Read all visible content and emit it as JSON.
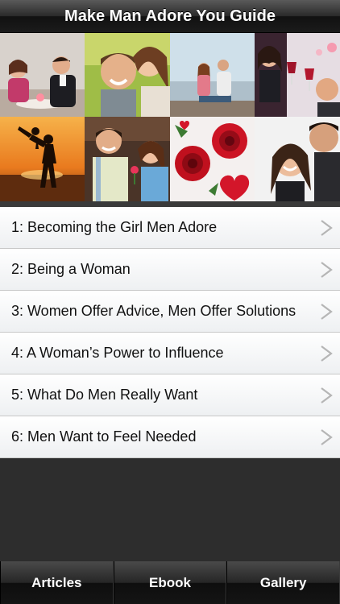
{
  "header": {
    "title": "Make Man Adore You Guide"
  },
  "collage": {
    "tiles": [
      {
        "icon": "couple-dinner-photo"
      },
      {
        "icon": "couple-laughing-photo"
      },
      {
        "icon": "couple-pier-photo"
      },
      {
        "icon": "couple-wine-toast-photo"
      },
      {
        "icon": "couple-sunset-silhouette-photo"
      },
      {
        "icon": "couple-gift-flower-photo"
      },
      {
        "icon": "red-roses-hearts-photo"
      },
      {
        "icon": "couple-kiss-photo"
      }
    ]
  },
  "articles": [
    {
      "label": "1: Becoming the Girl Men Adore"
    },
    {
      "label": "2: Being a Woman"
    },
    {
      "label": "3: Women Offer Advice, Men Offer Solutions"
    },
    {
      "label": "4: A Woman’s Power to Influence"
    },
    {
      "label": "5: What Do Men Really Want"
    },
    {
      "label": "6: Men Want to Feel Needed"
    }
  ],
  "chevron_glyph": ">",
  "tabs": [
    {
      "label": "Articles"
    },
    {
      "label": "Ebook"
    },
    {
      "label": "Gallery"
    }
  ],
  "colors": {
    "list_bg": "#eef0f2",
    "chevron": "#b5b5b5",
    "bar_dark": "#111111"
  }
}
